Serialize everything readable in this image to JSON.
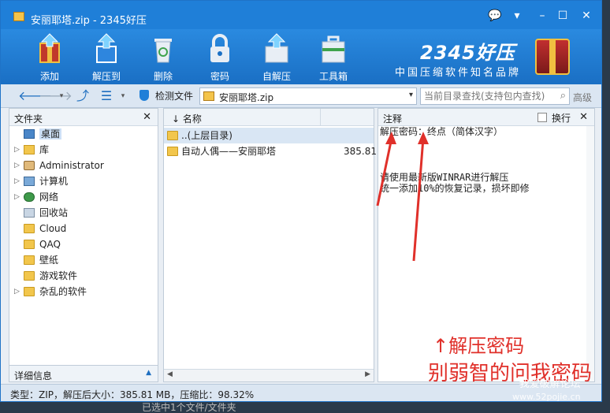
{
  "window": {
    "title": "安丽耶塔.zip - 2345好压"
  },
  "toolbar": {
    "add": "添加",
    "extract_to": "解压到",
    "delete": "删除",
    "password": "密码",
    "sfx": "自解压",
    "toolbox": "工具箱"
  },
  "brand": {
    "logo": "2345好压",
    "slogan": "中国压缩软件知名品牌"
  },
  "addressbar": {
    "detect_label": "检测文件",
    "path": "安丽耶塔.zip",
    "search_placeholder": "当前目录查找(支持包内查找)",
    "advanced": "高级"
  },
  "left_pane": {
    "title": "文件夹",
    "items": [
      {
        "label": "桌面",
        "icon": "desktop-icon",
        "selected": true
      },
      {
        "label": "库",
        "icon": "library-icon"
      },
      {
        "label": "Administrator",
        "icon": "user-icon"
      },
      {
        "label": "计算机",
        "icon": "computer-icon"
      },
      {
        "label": "网络",
        "icon": "network-icon"
      },
      {
        "label": "回收站",
        "icon": "recycle-bin-icon"
      },
      {
        "label": "Cloud",
        "icon": "folder-icon"
      },
      {
        "label": "QAQ",
        "icon": "folder-icon"
      },
      {
        "label": "壁纸",
        "icon": "folder-icon"
      },
      {
        "label": "游戏软件",
        "icon": "folder-icon"
      },
      {
        "label": "杂乱的软件",
        "icon": "folder-icon"
      }
    ],
    "footer": "详细信息"
  },
  "file_list": {
    "col_name": "名称",
    "rows": [
      {
        "name": "..(上层目录)",
        "size": ""
      },
      {
        "name": "自动人偶——安丽耶塔",
        "size": "385.81"
      }
    ]
  },
  "comment_pane": {
    "title": "注释",
    "wrap_label": "换行",
    "line1": "解压密码：终点（简体汉字）",
    "line2": "请使用最新版WINRAR进行解压",
    "line3": "统一添加10%的恢复记录，损坏即修"
  },
  "annotation": {
    "line1": "↑解压密码",
    "line2": "别弱智的问我密码"
  },
  "statusbar": {
    "text": "类型：ZIP，解压后大小：385.81 MB，压缩比：98.32%"
  },
  "behind_text": "已选中1个文件/文件夹",
  "watermark": {
    "line1": "我爱破解论坛",
    "line2": "www.52pojie.cn"
  },
  "colors": {
    "titlebar": "#1f7fd8",
    "annotation": "#e0302a"
  }
}
